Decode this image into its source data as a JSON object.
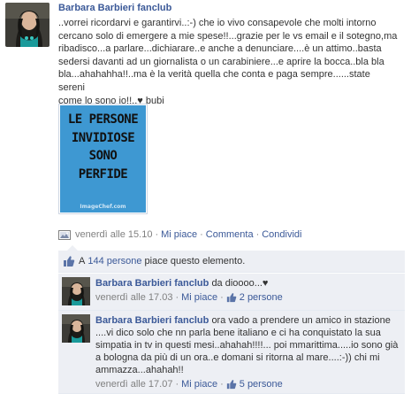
{
  "post": {
    "author": "Barbara Barbieri fanclub",
    "text": "..vorrei ricordarvi e garantirvi..:-) che io vivo consapevole che molti intorno\ncercano solo di emergere a mie spese!!...grazie per le vs email e il sotegno,ma\nribadisco...a parlare...dichiarare..e anche a denunciare....è un attimo..basta\nsedersi davanti ad un giornalista o un carabiniere...e aprire la bocca..bla bla\nbla...ahahahha!!..ma è la verità quella che conta e paga sempre......state sereni\ncome lo sono io!!..♥ bubi",
    "photo": {
      "lines": [
        "LE PERSONE",
        "INVIDIOSE",
        "SONO",
        "PERFIDE"
      ],
      "watermark": "ImageChef.com"
    },
    "timestamp": "venerdì alle 15.10",
    "actions": {
      "like": "Mi piace",
      "comment": "Commenta",
      "share": "Condividi"
    }
  },
  "likes": {
    "prefix": "A",
    "count_link": "144 persone",
    "suffix": "piace questo elemento."
  },
  "comments": [
    {
      "author": "Barbara Barbieri fanclub",
      "text": "da dioooo...♥",
      "timestamp": "venerdì alle 17.03",
      "like": "Mi piace",
      "likes_count": "2 persone"
    },
    {
      "author": "Barbara Barbieri fanclub",
      "text": "ora vado a prendere un amico in stazione ....vi dico solo che nn parla bene italiano e ci ha conquistato la sua simpatia in tv in questi mesi..ahahah!!!!... poi mmarittima.....io sono già a bologna da più di un ora..e domani si ritorna al mare....:-)) chi mi ammazza...ahahah!!",
      "timestamp": "venerdì alle 17.07",
      "like": "Mi piace",
      "likes_count": "5 persone"
    }
  ],
  "colors": {
    "link": "#3b5998",
    "meta": "#808080",
    "comment_bg": "#edeff4",
    "photo_bg": "#3e98d2"
  },
  "icons": {
    "post_type": "photo-icon",
    "likes": "thumbs-up-icon"
  }
}
